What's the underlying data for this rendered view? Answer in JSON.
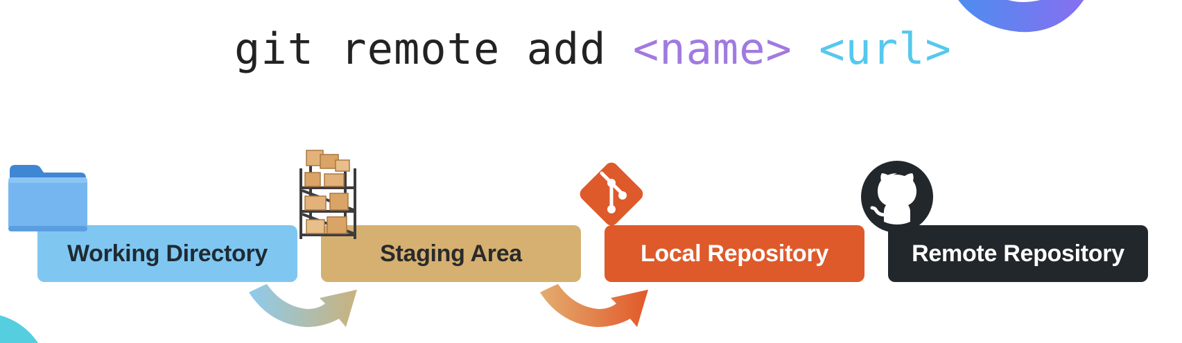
{
  "command": {
    "base": "git remote add ",
    "name_arg": "<name>",
    "space": " ",
    "url_arg": "<url>",
    "colors": {
      "base": "#222222",
      "name_arg": "#a07ae0",
      "url_arg": "#55c8ee"
    }
  },
  "stages": [
    {
      "label": "Working Directory",
      "icon": "folder-icon",
      "bg": "#7fc7f1",
      "fg": "#1f2a33"
    },
    {
      "label": "Staging Area",
      "icon": "shelf-boxes-icon",
      "bg": "#d6b071",
      "fg": "#2a2a2a"
    },
    {
      "label": "Local Repository",
      "icon": "git-logo-icon",
      "bg": "#de5a2a",
      "fg": "#ffffff"
    },
    {
      "label": "Remote Repository",
      "icon": "github-logo-icon",
      "bg": "#22272b",
      "fg": "#ffffff"
    }
  ],
  "arrows": [
    {
      "from": "Working Directory",
      "to": "Staging Area",
      "colors": [
        "#8ecbed",
        "#c9b27c"
      ]
    },
    {
      "from": "Staging Area",
      "to": "Local Repository",
      "colors": [
        "#e3ad6f",
        "#e2582a"
      ]
    }
  ]
}
